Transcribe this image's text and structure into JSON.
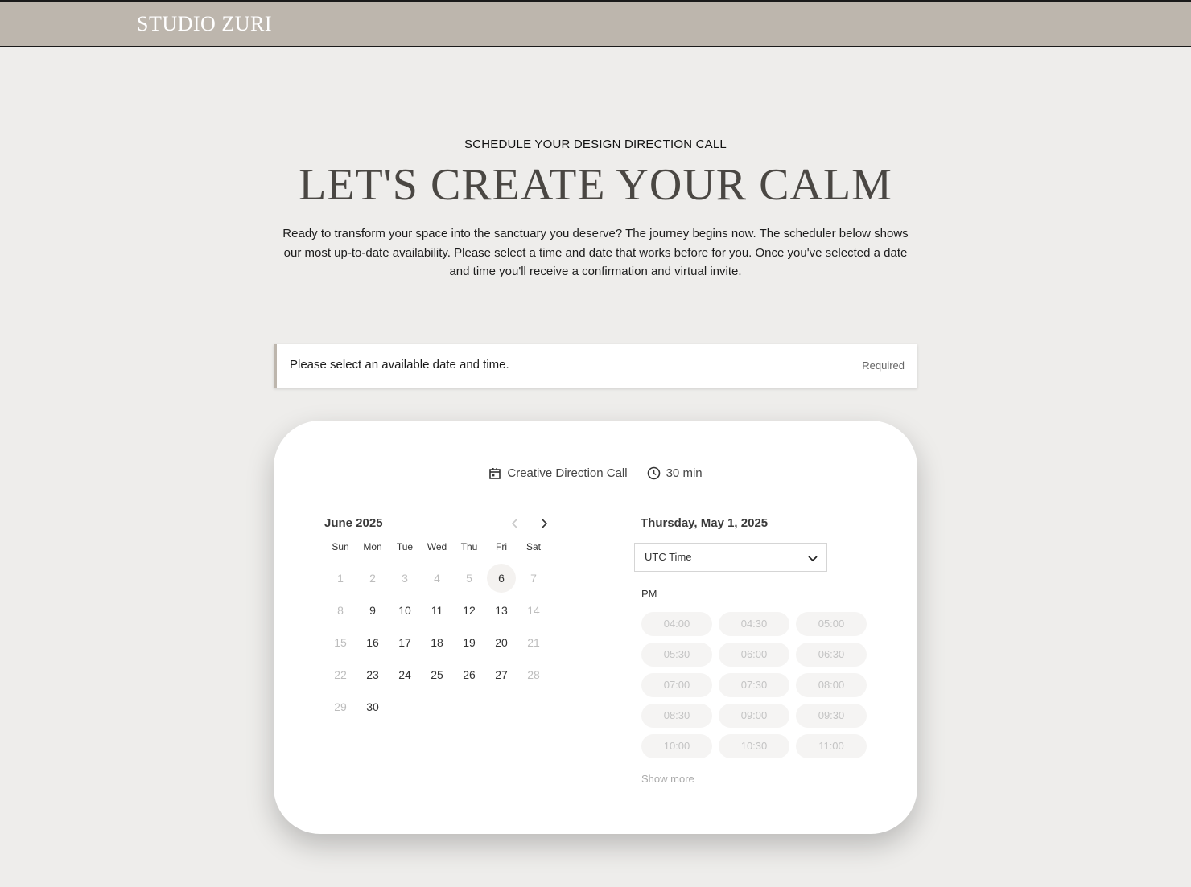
{
  "header": {
    "brand": "STUDIO ZURI"
  },
  "hero": {
    "eyebrow": "SCHEDULE YOUR DESIGN DIRECTION CALL",
    "title": "LET'S CREATE YOUR CALM",
    "intro": "Ready to transform your space into the sanctuary you deserve? The journey begins now. The scheduler below shows our most up-to-date availability. Please select a time and date that works before for you. Once you've selected a date and time you'll receive a confirmation and virtual invite."
  },
  "notice": {
    "text": "Please select an available date and time.",
    "required": "Required"
  },
  "scheduler": {
    "event_name": "Creative Direction Call",
    "duration": "30 min",
    "calendar": {
      "month_label": "June 2025",
      "weekdays": [
        "Sun",
        "Mon",
        "Tue",
        "Wed",
        "Thu",
        "Fri",
        "Sat"
      ],
      "days": [
        {
          "label": "1",
          "available": false
        },
        {
          "label": "2",
          "available": false
        },
        {
          "label": "3",
          "available": false
        },
        {
          "label": "4",
          "available": false
        },
        {
          "label": "5",
          "available": false
        },
        {
          "label": "6",
          "available": true,
          "selected": true
        },
        {
          "label": "7",
          "available": false
        },
        {
          "label": "8",
          "available": false
        },
        {
          "label": "9",
          "available": true
        },
        {
          "label": "10",
          "available": true
        },
        {
          "label": "11",
          "available": true
        },
        {
          "label": "12",
          "available": true
        },
        {
          "label": "13",
          "available": true
        },
        {
          "label": "14",
          "available": false
        },
        {
          "label": "15",
          "available": false
        },
        {
          "label": "16",
          "available": true
        },
        {
          "label": "17",
          "available": true
        },
        {
          "label": "18",
          "available": true
        },
        {
          "label": "19",
          "available": true
        },
        {
          "label": "20",
          "available": true
        },
        {
          "label": "21",
          "available": false
        },
        {
          "label": "22",
          "available": false
        },
        {
          "label": "23",
          "available": true
        },
        {
          "label": "24",
          "available": true
        },
        {
          "label": "25",
          "available": true
        },
        {
          "label": "26",
          "available": true
        },
        {
          "label": "27",
          "available": true
        },
        {
          "label": "28",
          "available": false
        },
        {
          "label": "29",
          "available": false
        },
        {
          "label": "30",
          "available": true
        }
      ]
    },
    "selected_date": "Thursday, May 1, 2025",
    "timezone": "UTC Time",
    "period": "PM",
    "slots": [
      "04:00",
      "04:30",
      "05:00",
      "05:30",
      "06:00",
      "06:30",
      "07:00",
      "07:30",
      "08:00",
      "08:30",
      "09:00",
      "09:30",
      "10:00",
      "10:30",
      "11:00"
    ],
    "show_more": "Show more"
  },
  "colors": {
    "header_bg": "#bdb6ad",
    "page_bg": "#eeedeb",
    "accent_border": "#bdb6ad"
  }
}
